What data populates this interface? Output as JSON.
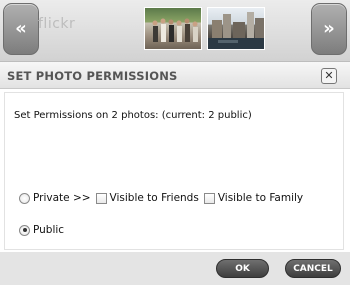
{
  "strip": {
    "prev_label": "«",
    "next_label": "»",
    "brand": "flickr"
  },
  "dialog": {
    "title": "SET PHOTO PERMISSIONS",
    "close_label": "✕",
    "summary": "Set Permissions on 2 photos: (current: 2 public)",
    "options": {
      "private_label": "Private >>",
      "friends_label": "Visible to Friends",
      "family_label": "Visible to Family",
      "public_label": "Public",
      "selected": "public"
    },
    "ok_label": "OK",
    "cancel_label": "CANCEL"
  }
}
